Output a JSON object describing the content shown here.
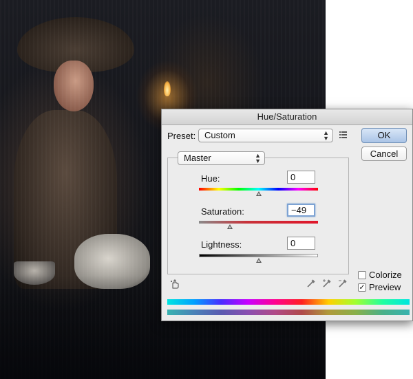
{
  "dialog": {
    "title": "Hue/Saturation",
    "preset_label": "Preset:",
    "preset_value": "Custom",
    "channel_value": "Master",
    "ok_label": "OK",
    "cancel_label": "Cancel",
    "hue_label": "Hue:",
    "hue_value": "0",
    "saturation_label": "Saturation:",
    "saturation_value": "−49",
    "lightness_label": "Lightness:",
    "lightness_value": "0",
    "colorize_label": "Colorize",
    "colorize_checked": false,
    "preview_label": "Preview",
    "preview_checked": true
  },
  "icons": {
    "preset_options": "preset-options-icon",
    "targeted_adjustment": "hand-adjust-icon",
    "eyedroppers": [
      "eyedropper-icon",
      "eyedropper-plus-icon",
      "eyedropper-minus-icon"
    ]
  },
  "colors": {
    "ok_button": "#aac4e6",
    "focus_ring": "#7da3d3"
  }
}
